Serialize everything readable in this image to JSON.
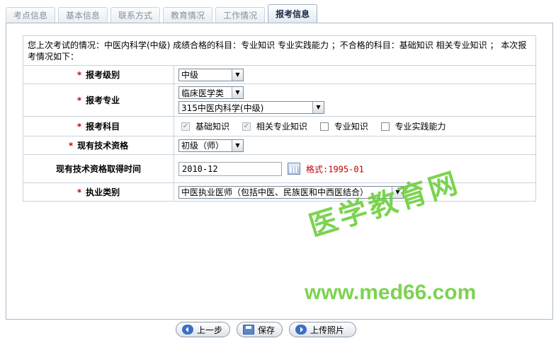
{
  "tabs": [
    {
      "label": "考点信息",
      "active": false
    },
    {
      "label": "基本信息",
      "active": false
    },
    {
      "label": "联系方式",
      "active": false
    },
    {
      "label": "教育情况",
      "active": false
    },
    {
      "label": "工作情况",
      "active": false
    },
    {
      "label": "报考信息",
      "active": true
    }
  ],
  "info_text": "您上次考试的情况：中医内科学(中级) 成绩合格的科目：专业知识 专业实践能力 ；不合格的科目：基础知识 相关专业知识 ； 本次报考情况如下：",
  "required_mark": "*",
  "form": {
    "level": {
      "label": "报考级别",
      "value": "中级"
    },
    "major": {
      "label": "报考专业",
      "category": "临床医学类",
      "value": "315中医内科学(中级)"
    },
    "subjects": {
      "label": "报考科目",
      "items": [
        {
          "name": "基础知识",
          "checked": true,
          "disabled": true
        },
        {
          "name": "相关专业知识",
          "checked": true,
          "disabled": true
        },
        {
          "name": "专业知识",
          "checked": false
        },
        {
          "name": "专业实践能力",
          "checked": false
        }
      ]
    },
    "qualification": {
      "label": "现有技术资格",
      "value": "初级（师）"
    },
    "qual_date": {
      "label": "现有技术资格取得时间",
      "value": "2010-12",
      "format_hint": "格式:1995-01"
    },
    "practice": {
      "label": "执业类别",
      "value": "中医执业医师（包括中医、民族医和中西医结合）"
    }
  },
  "watermark": {
    "cn": "医学教育网",
    "url": "www.med66.com"
  },
  "buttons": {
    "prev": "上一步",
    "save": "保存",
    "upload": "上传照片"
  },
  "colors": {
    "required": "#d00000",
    "hint": "#c00000",
    "watermark": "#66cc33",
    "border": "#c8d3de"
  }
}
